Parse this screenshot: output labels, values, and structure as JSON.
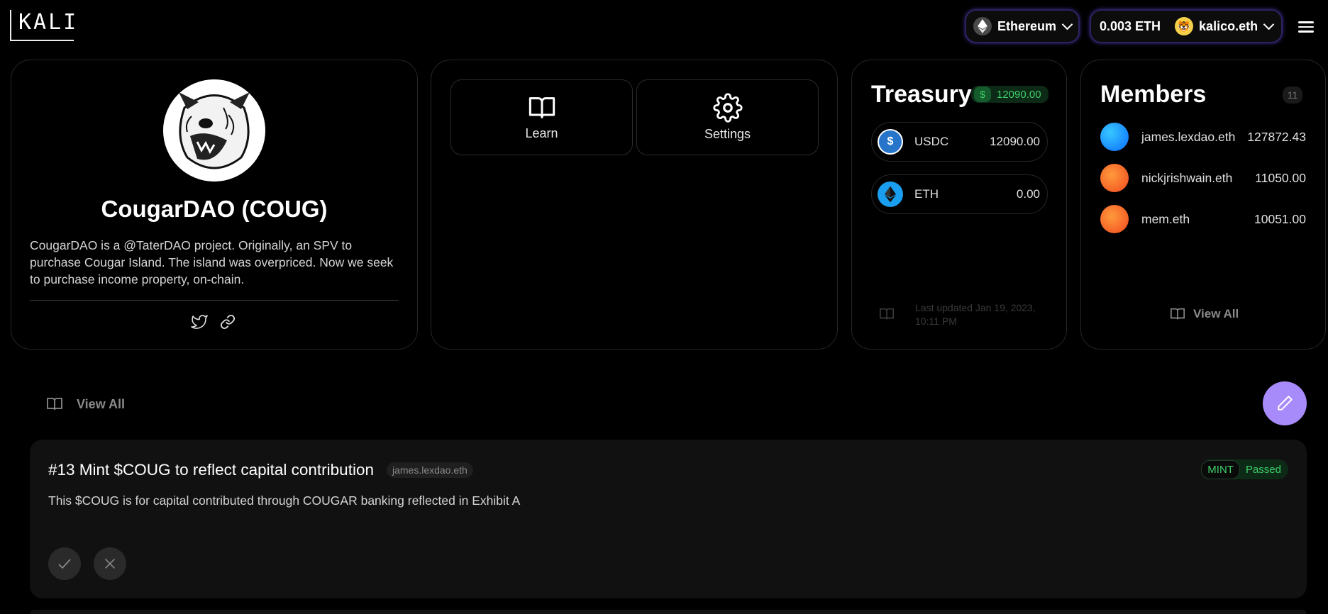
{
  "header": {
    "logo": "KALI",
    "network": "Ethereum",
    "balance": "0.003 ETH",
    "account": "kalico.eth"
  },
  "profile": {
    "name": "CougarDAO (COUG)",
    "description": "CougarDAO is a @TaterDAO project. Originally, an SPV to purchase Cougar Island. The island was overpriced. Now we seek to purchase income property, on-chain."
  },
  "actions": {
    "learn": "Learn",
    "settings": "Settings"
  },
  "treasury": {
    "title": "Treasury",
    "currency_symbol": "$",
    "total": "12090.00",
    "assets": [
      {
        "name": "USDC",
        "value": "12090.00",
        "icon": "usdc-icon"
      },
      {
        "name": "ETH",
        "value": "0.00",
        "icon": "eth-icon"
      }
    ],
    "last_updated": "Last updated Jan 19, 2023, 10:11 PM"
  },
  "members": {
    "title": "Members",
    "count": "11",
    "items": [
      {
        "name": "james.lexdao.eth",
        "value": "127872.43"
      },
      {
        "name": "nickjrishwain.eth",
        "value": "11050.00"
      },
      {
        "name": "mem.eth",
        "value": "10051.00"
      }
    ],
    "view_all": "View All"
  },
  "proposals": {
    "view_all": "View All",
    "items": [
      {
        "title": "#13 Mint $COUG to reflect capital contribution",
        "proposer": "james.lexdao.eth",
        "type": "MINT",
        "status": "Passed",
        "description": "This $COUG is for capital contributed through COUGAR banking reflected in Exhibit A"
      }
    ]
  },
  "colors": {
    "accent": "#a78bfa",
    "success": "#3ecf6a",
    "background": "#000000",
    "card_border": "#262626"
  }
}
